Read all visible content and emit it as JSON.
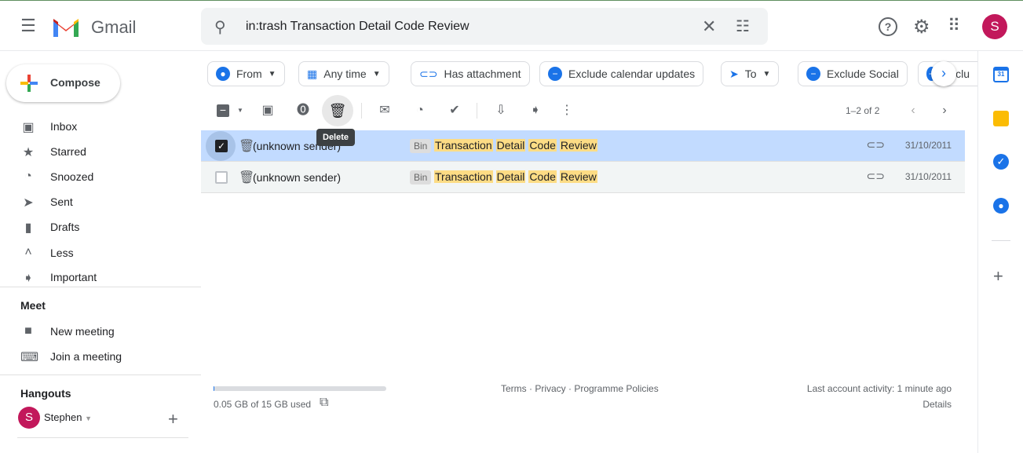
{
  "header": {
    "app_name": "Gmail",
    "search_query": "in:trash Transaction Detail Code Review",
    "avatar_letter": "S"
  },
  "compose_label": "Compose",
  "sidebar": {
    "items": [
      {
        "label": "Inbox",
        "icon": "inbox-icon"
      },
      {
        "label": "Starred",
        "icon": "star-icon"
      },
      {
        "label": "Snoozed",
        "icon": "clock-icon"
      },
      {
        "label": "Sent",
        "icon": "send-icon"
      },
      {
        "label": "Drafts",
        "icon": "draft-icon"
      },
      {
        "label": "Less",
        "icon": "chevron-up-icon"
      },
      {
        "label": "Important",
        "icon": "important-icon"
      }
    ],
    "meet": {
      "title": "Meet",
      "items": [
        {
          "label": "New meeting"
        },
        {
          "label": "Join a meeting"
        }
      ]
    },
    "hangouts": {
      "title": "Hangouts",
      "user": "Stephen",
      "avatar_letter": "S"
    }
  },
  "filters": [
    {
      "label": "From"
    },
    {
      "label": "Any time"
    },
    {
      "label": "Has attachment"
    },
    {
      "label": "Exclude calendar updates"
    },
    {
      "label": "To"
    },
    {
      "label": "Exclude Social"
    },
    {
      "label": "Exclu"
    }
  ],
  "toolbar": {
    "pagination": "1–2 of 2",
    "tooltip": "Delete"
  },
  "emails": [
    {
      "sender": "(unknown sender)",
      "label": "Bin",
      "subject": [
        "Transaction",
        "Detail",
        "Code",
        "Review"
      ],
      "date": "31/10/2011",
      "selected": true
    },
    {
      "sender": "(unknown sender)",
      "label": "Bin",
      "subject": [
        "Transaction",
        "Detail",
        "Code",
        "Review"
      ],
      "date": "31/10/2011",
      "selected": false
    }
  ],
  "footer": {
    "storage": "0.05 GB of 15 GB used",
    "storage_fraction": 0.0033,
    "links": "Terms · Privacy · Programme Policies",
    "activity": "Last account activity: 1 minute ago",
    "details": "Details"
  },
  "colors": {
    "selected_row": "#c2dbff",
    "highlight": "#fddc85",
    "accent": "#1a73e8",
    "avatar": "#c2185b"
  }
}
